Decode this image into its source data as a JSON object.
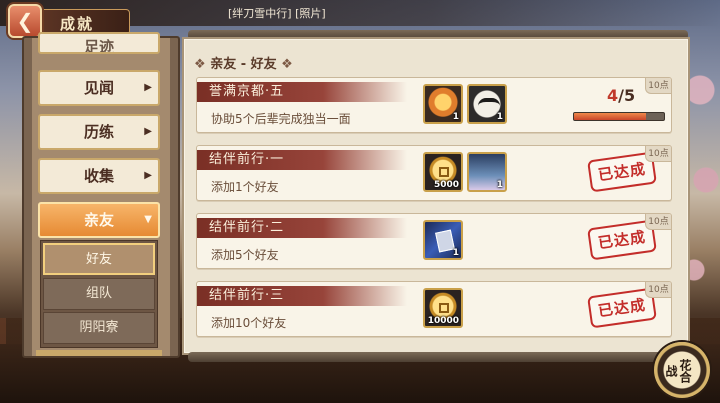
{
  "header": {
    "back_icon": "chevron-left-icon",
    "title": "成就",
    "chat_line": "[绊刀雪中行] [照片]"
  },
  "nav": {
    "partial_item": "足迹",
    "items": [
      {
        "label": "见闻"
      },
      {
        "label": "历练"
      },
      {
        "label": "收集"
      },
      {
        "label": "亲友"
      }
    ],
    "active_index": 3,
    "sub_items": [
      {
        "label": "好友"
      },
      {
        "label": "组队"
      },
      {
        "label": "阴阳寮"
      }
    ],
    "selected_sub_index": 0
  },
  "section": {
    "title": "亲友 - 好友"
  },
  "achievements": [
    {
      "title": "誉满京都·五",
      "description": "协助5个后辈完成独当一面",
      "points": "10点",
      "rewards": [
        {
          "icon": "gift-bag-icon",
          "qty": "1"
        },
        {
          "icon": "daruma-mask-icon",
          "qty": "1"
        }
      ],
      "progress_current": "4",
      "progress_total": "/5",
      "progress_fraction": 0.8,
      "done": false
    },
    {
      "title": "结伴前行·一",
      "description": "添加1个好友",
      "points": "10点",
      "rewards": [
        {
          "icon": "gold-coin-icon",
          "qty": "5000"
        },
        {
          "icon": "shikigami-portrait-icon",
          "qty": "1"
        }
      ],
      "done": true,
      "stamp": "已达成"
    },
    {
      "title": "结伴前行·二",
      "description": "添加5个好友",
      "points": "10点",
      "rewards": [
        {
          "icon": "summon-card-icon",
          "qty": "1"
        }
      ],
      "done": true,
      "stamp": "已达成"
    },
    {
      "title": "结伴前行·三",
      "description": "添加10个好友",
      "points": "10点",
      "rewards": [
        {
          "icon": "gold-coin-icon",
          "qty": "10000"
        }
      ],
      "done": true,
      "stamp": "已达成"
    }
  ],
  "hanafuda_button": {
    "label": "花合战"
  }
}
